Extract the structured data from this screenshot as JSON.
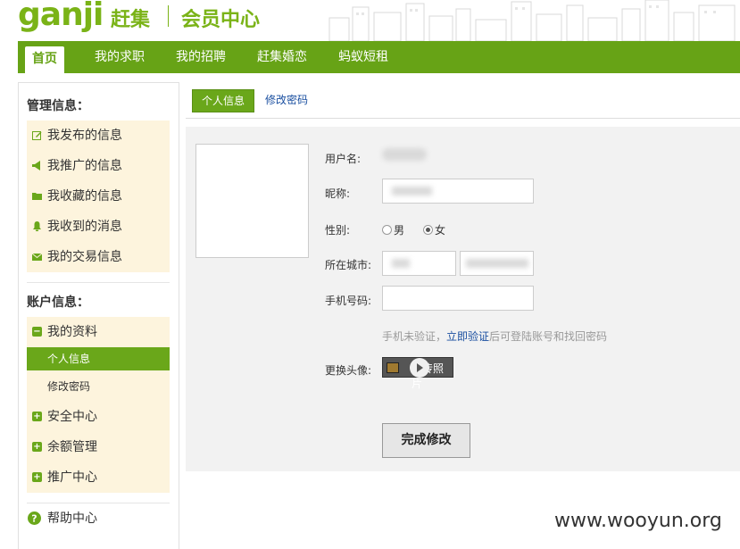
{
  "header": {
    "logo_text": "ganji",
    "logo_cn": "赶集",
    "title": "会员中心",
    "brand_color": "#7ab317"
  },
  "nav": {
    "items": [
      {
        "label": "首页",
        "active": true
      },
      {
        "label": "我的求职"
      },
      {
        "label": "我的招聘"
      },
      {
        "label": "赶集婚恋"
      },
      {
        "label": "蚂蚁短租"
      }
    ]
  },
  "sidebar": {
    "manage_title": "管理信息：",
    "manage_items": [
      {
        "label": "我发布的信息",
        "icon": "edit-icon"
      },
      {
        "label": "我推广的信息",
        "icon": "megaphone-icon"
      },
      {
        "label": "我收藏的信息",
        "icon": "folder-icon"
      },
      {
        "label": "我收到的消息",
        "icon": "bell-icon"
      },
      {
        "label": "我的交易信息",
        "icon": "mail-icon"
      }
    ],
    "account_title": "账户信息：",
    "profile_label": "我的资料",
    "profile_subitems": [
      {
        "label": "个人信息",
        "active": true
      },
      {
        "label": "修改密码"
      }
    ],
    "more_items": [
      {
        "label": "安全中心"
      },
      {
        "label": "余额管理"
      },
      {
        "label": "推广中心"
      }
    ],
    "help_label": "帮助中心"
  },
  "tabs": [
    {
      "label": "个人信息",
      "active": true
    },
    {
      "label": "修改密码"
    }
  ],
  "form": {
    "username_label": "用户名:",
    "nickname_label": "昵称:",
    "gender_label": "性别:",
    "gender_options": [
      {
        "label": "男",
        "checked": false
      },
      {
        "label": "女",
        "checked": true
      }
    ],
    "city_label": "所在城市:",
    "phone_label": "手机号码:",
    "phone_value": "",
    "hint_prefix": "手机未验证，",
    "hint_link": "立即验证",
    "hint_suffix": "后可登陆账号和找回密码",
    "avatar_label": "更换头像:",
    "upload_label": "上传照片",
    "submit_label": "完成修改"
  },
  "watermark": "www.wooyun.org"
}
